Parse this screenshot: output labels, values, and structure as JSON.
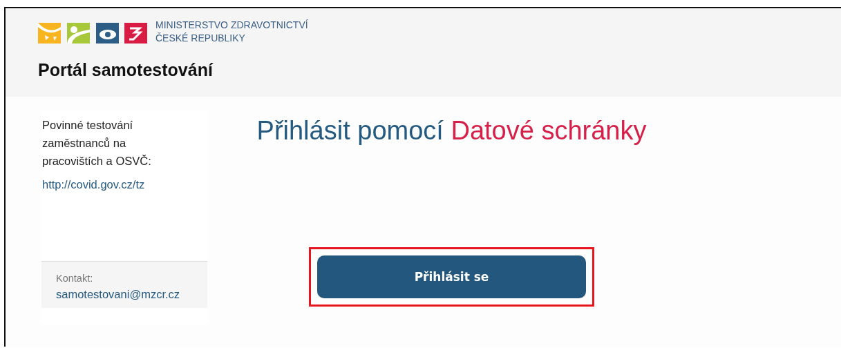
{
  "header": {
    "ministry_line_1": "MINISTERSTVO ZDRAVOTNICTVÍ",
    "ministry_line_2": "ČESKÉ REPUBLIKY",
    "portal_title": "Portál samotestování"
  },
  "sidebar": {
    "info_text": "Povinné testování zaměstnanců na pracovištích a OSVČ:",
    "info_link": "http://covid.gov.cz/tz",
    "contact_label": "Kontakt:",
    "contact_email": "samotestovani@mzcr.cz"
  },
  "main": {
    "heading": "Přihlásit pomocí",
    "heading_highlight": "Datové schránky",
    "login_button": {
      "label": "Přihlásit se",
      "highlighted": true
    }
  }
}
